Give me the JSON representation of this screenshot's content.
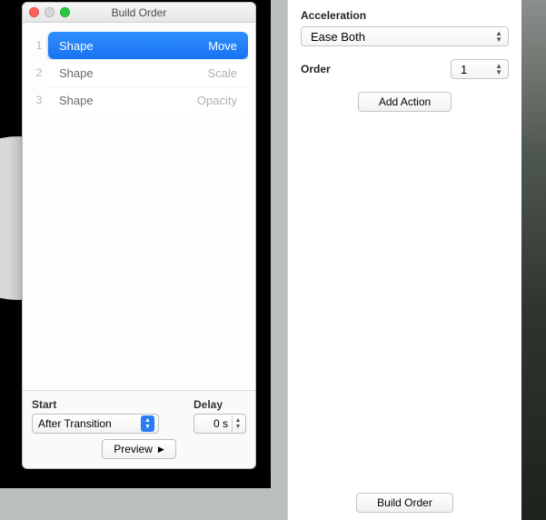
{
  "window": {
    "title": "Build Order",
    "builds": [
      {
        "index": "1",
        "name": "Shape",
        "effect": "Move",
        "selected": true
      },
      {
        "index": "2",
        "name": "Shape",
        "effect": "Scale",
        "selected": false
      },
      {
        "index": "3",
        "name": "Shape",
        "effect": "Opacity",
        "selected": false
      }
    ],
    "start_label": "Start",
    "start_value": "After Transition",
    "delay_label": "Delay",
    "delay_value": "0 s",
    "preview_label": "Preview"
  },
  "inspector": {
    "acceleration_label": "Acceleration",
    "acceleration_value": "Ease Both",
    "order_label": "Order",
    "order_value": "1",
    "add_action_label": "Add Action",
    "build_order_label": "Build Order"
  }
}
